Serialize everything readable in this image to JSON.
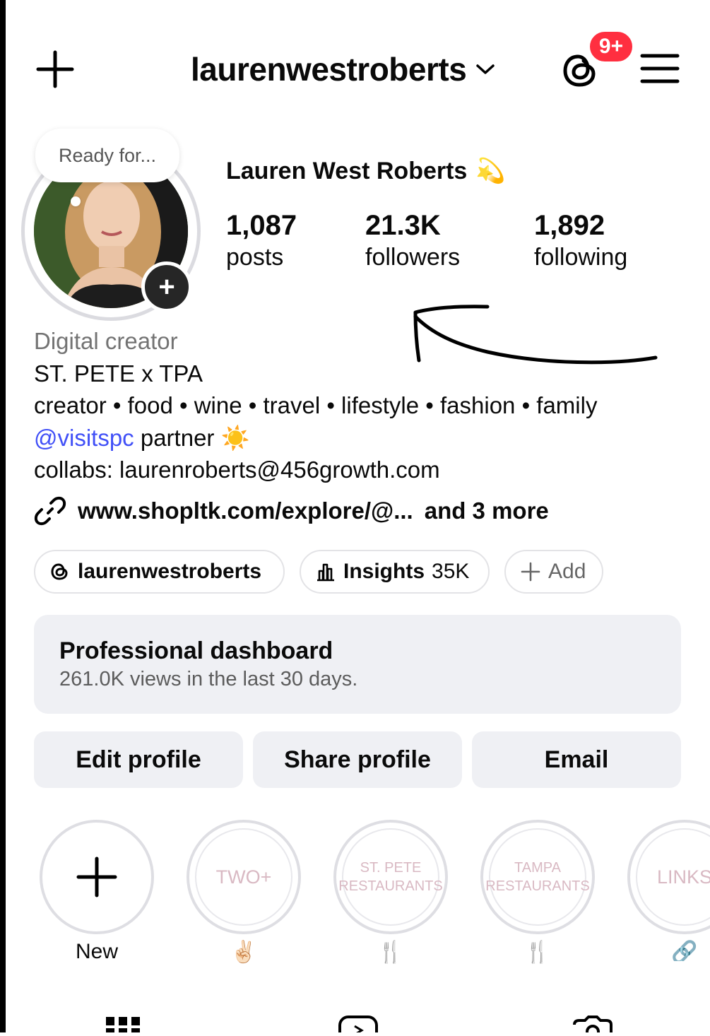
{
  "header": {
    "username": "laurenwestroberts",
    "notification_badge": "9+"
  },
  "profile": {
    "note": "Ready for...",
    "full_name": "Lauren West Roberts",
    "name_emoji": "💫",
    "stats": [
      {
        "value": "1,087",
        "label": "posts"
      },
      {
        "value": "21.3K",
        "label": "followers"
      },
      {
        "value": "1,892",
        "label": "following"
      }
    ]
  },
  "bio": {
    "category": "Digital creator",
    "line1": "ST. PETE x TPA",
    "line2": "creator • food • wine • travel • lifestyle • fashion • family",
    "mention": "@visitspc",
    "line3_rest": " partner ☀️",
    "line4": "collabs: laurenroberts@456growth.com",
    "link": "www.shopltk.com/explore/@...",
    "link_more": "and 3 more"
  },
  "pills": {
    "threads": "laurenwestroberts",
    "insights_label": "Insights",
    "insights_value": "35K",
    "add": "Add"
  },
  "dashboard": {
    "title": "Professional dashboard",
    "subtitle": "261.0K views in the last 30 days."
  },
  "actions": {
    "edit": "Edit profile",
    "share": "Share profile",
    "email": "Email"
  },
  "highlights": [
    {
      "cover": "",
      "label": "New"
    },
    {
      "cover": "TWO+",
      "label": "✌🏻"
    },
    {
      "cover": "ST. PETE RESTAURANTS",
      "label": "🍴"
    },
    {
      "cover": "TAMPA RESTAURANTS",
      "label": "🍴"
    },
    {
      "cover": "LINKS",
      "label": "🔗"
    }
  ],
  "colors": {
    "badge": "#ff2f40",
    "mention": "#4150f7",
    "button_bg": "#eff0f4"
  }
}
